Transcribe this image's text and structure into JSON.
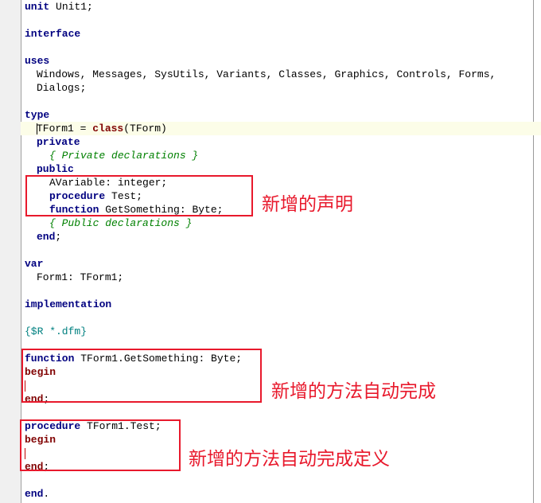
{
  "code": {
    "l1_kw": "unit",
    "l1_rest": " Unit1;",
    "l2_kw": "interface",
    "l3_kw": "uses",
    "l4_text": "Windows, Messages, SysUtils, Variants, Classes, Graphics, Controls, Forms,",
    "l5_text": "Dialogs;",
    "l6_kw": "type",
    "l7_a": "TForm1 = ",
    "l7_kw": "class",
    "l7_b": "(TForm)",
    "l8_kw": "private",
    "l9_comment": "{ Private declarations }",
    "l10_kw": "public",
    "l11_text": "AVariable: integer;",
    "l12_kw": "procedure",
    "l12_rest": " Test;",
    "l13_kw": "function",
    "l13_rest": " GetSomething: Byte;",
    "l14_comment": "{ Public declarations }",
    "l15_kw": "end",
    "l15_rest": ";",
    "l16_kw": "var",
    "l17_text": "Form1: TForm1;",
    "l18_kw": "implementation",
    "l19_directive": "{$R *.dfm}",
    "l20_kw": "function",
    "l20_rest": " TForm1.GetSomething: Byte;",
    "l21_kw": "begin",
    "l23_kw": "end",
    "l23_rest": ";",
    "l24_kw": "procedure",
    "l24_rest": " TForm1.Test;",
    "l25_kw": "begin",
    "l27_kw": "end",
    "l27_rest": ";",
    "l28_kw": "end",
    "l28_rest": "."
  },
  "annotations": {
    "declarations": "新增的声明",
    "method_autocomplete": "新增的方法自动完成",
    "method_autocomplete_definition": "新增的方法自动完成定义"
  },
  "colors": {
    "keyword": "#000080",
    "block_keyword": "#800000",
    "comment": "#008000",
    "directive": "#008080",
    "annotation": "#e8192c",
    "current_line": "#fcfde8"
  }
}
